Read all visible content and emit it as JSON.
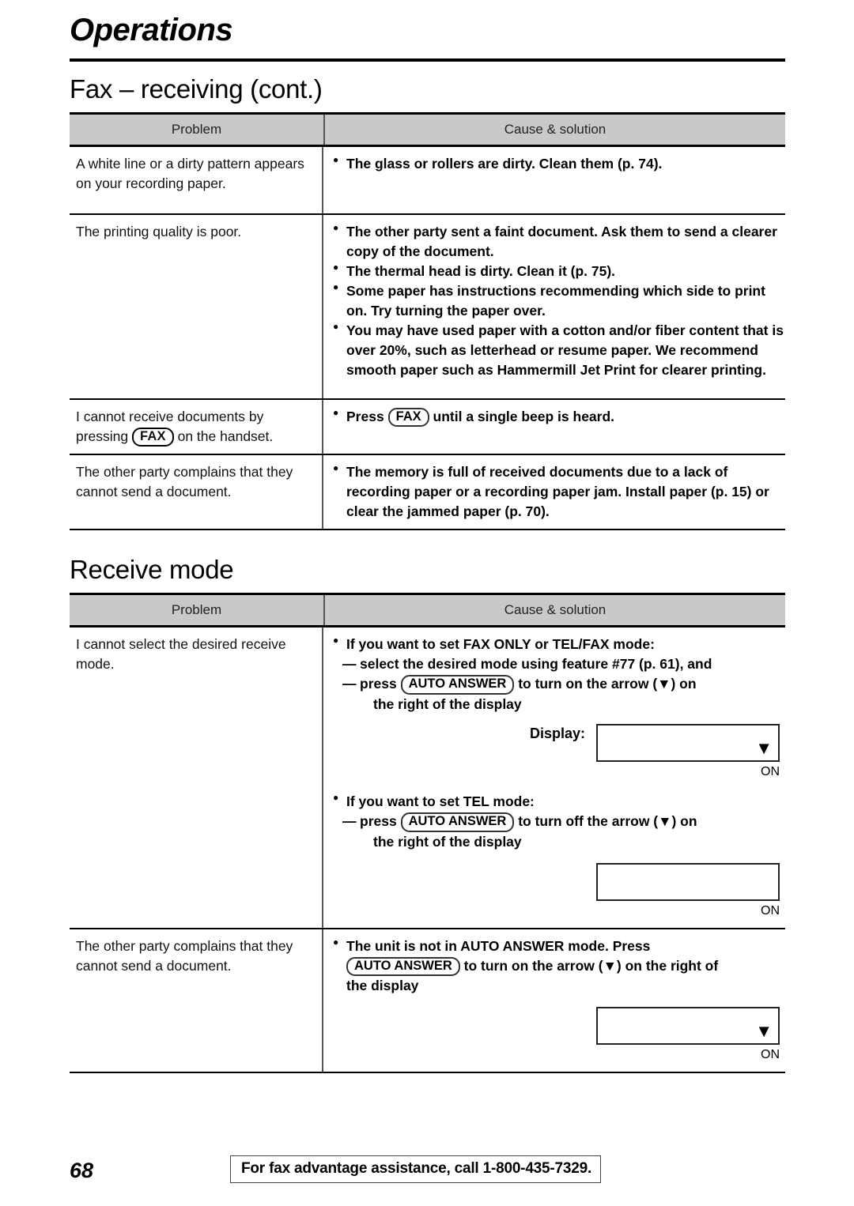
{
  "page": {
    "chapter_title": "Operations",
    "page_number": "68",
    "footer_note": "For fax advantage assistance, call 1-800-435-7329."
  },
  "sections": [
    {
      "title": "Fax – receiving (cont.)",
      "headers": {
        "problem": "Problem",
        "cause": "Cause & solution"
      },
      "rows": [
        {
          "problem": "A white line or a dirty pattern appears on your recording paper.",
          "bullets": [
            "The glass or rollers are dirty. Clean them (p. 74)."
          ]
        },
        {
          "problem": "The printing quality is poor.",
          "bullets": [
            "The other party sent a faint document. Ask them to send a clearer copy of the document.",
            "The thermal head is dirty. Clean it (p. 75).",
            "Some paper has instructions recommending which side to print on. Try turning the paper over.",
            "You may have used paper with a cotton and/or fiber content that is over 20%, such as letterhead or resume paper. We recommend smooth paper such as Hammermill Jet Print for clearer printing."
          ]
        },
        {
          "problem_parts": {
            "pre": "I cannot receive documents by pressing",
            "key": "FAX",
            "post": "on the handset."
          },
          "bullet_parts": {
            "pre": "Press",
            "key": "FAX",
            "post": "until a single beep is heard."
          }
        },
        {
          "problem": "The other party complains that they cannot send a document.",
          "bullets": [
            "The memory is full of received documents due to a lack of recording paper or a recording paper jam. Install paper (p. 15) or clear the jammed paper (p. 70)."
          ]
        }
      ]
    },
    {
      "title": "Receive mode",
      "headers": {
        "problem": "Problem",
        "cause": "Cause & solution"
      },
      "rows": [
        {
          "problem": "I cannot select the desired receive mode.",
          "block_a": {
            "bullet": "If you want to set FAX ONLY or TEL/FAX mode:",
            "dash1": "select the desired mode using feature #77 (p. 61), and",
            "dash2_pre": "press",
            "dash2_key": "AUTO ANSWER",
            "dash2_post": "to turn on the arrow (▼) on",
            "dash2_cont": "the right of the display",
            "display_label": "Display:",
            "display_arrow": true,
            "display_on": "ON"
          },
          "block_b": {
            "bullet": "If you want to set TEL mode:",
            "dash_pre": "press",
            "dash_key": "AUTO ANSWER",
            "dash_post": "to turn off the arrow (▼) on",
            "dash_cont": "the right of the display",
            "display_arrow": false,
            "display_on": "ON"
          }
        },
        {
          "problem": "The other party complains that they cannot send a document.",
          "block_c": {
            "line1": "The unit is not in AUTO ANSWER mode. Press",
            "line2_key": "AUTO ANSWER",
            "line2_post": "to turn on the arrow (▼) on the right of",
            "line3": "the display",
            "display_arrow": true,
            "display_on": "ON"
          }
        }
      ]
    }
  ],
  "icons": {
    "arrow_down": "▼",
    "bullet": "●",
    "em_dash": "—"
  }
}
